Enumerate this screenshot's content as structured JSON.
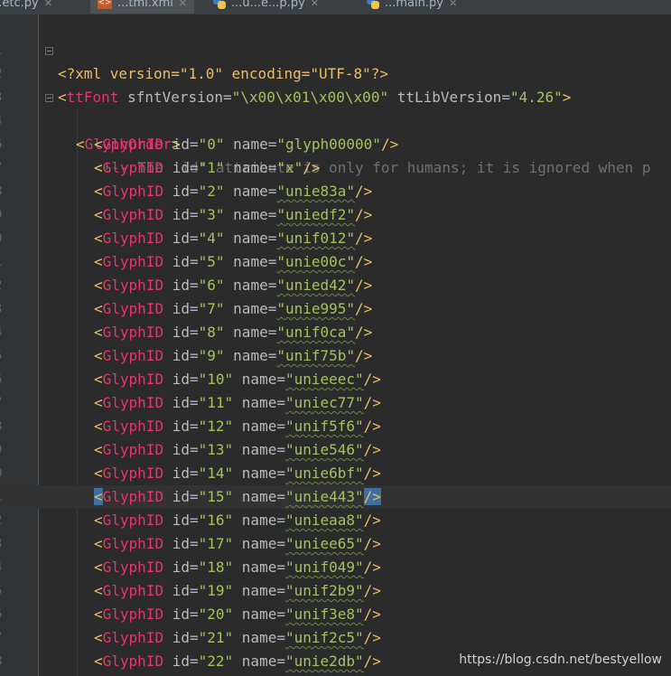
{
  "tabs": [
    {
      "label": "...etc.py",
      "icon": "python-file-icon"
    },
    {
      "label": "...tml.xml",
      "icon": "xml-file-icon"
    },
    {
      "label": "...u...e...p.py",
      "icon": "python-file-icon"
    },
    {
      "label": "...main.py",
      "icon": "python-file-icon"
    }
  ],
  "editor": {
    "header_lines": [
      {
        "num": "1",
        "pi": "<?xml version=\"1.0\" encoding=\"UTF-8\"?>"
      },
      {
        "num": "2",
        "tag": "ttFont",
        "attr1": "sfntVersion",
        "val1": "\"\\x00\\x01\\x00\\x00\"",
        "attr2": "ttLibVersion",
        "val2": "\"4.26\""
      },
      {
        "num": "3"
      },
      {
        "num": "4",
        "tag": "GlyphOrder"
      },
      {
        "num": "5",
        "comment": "<!-- The 'id' attribute is only for humans; it is ignored when p"
      }
    ],
    "glyphs": [
      {
        "num": "6",
        "id": "\"0\"",
        "name": "\"glyph00000\"",
        "underline": false
      },
      {
        "num": "7",
        "id": "\"1\"",
        "name": "\"x\"",
        "underline": false
      },
      {
        "num": "8",
        "id": "\"2\"",
        "name": "\"unie83a\"",
        "underline": true
      },
      {
        "num": "9",
        "id": "\"3\"",
        "name": "\"uniedf2\"",
        "underline": true
      },
      {
        "num": "0",
        "id": "\"4\"",
        "name": "\"unif012\"",
        "underline": true
      },
      {
        "num": "1",
        "id": "\"5\"",
        "name": "\"unie00c\"",
        "underline": true
      },
      {
        "num": "2",
        "id": "\"6\"",
        "name": "\"unied42\"",
        "underline": true
      },
      {
        "num": "3",
        "id": "\"7\"",
        "name": "\"unie995\"",
        "underline": true
      },
      {
        "num": "4",
        "id": "\"8\"",
        "name": "\"unif0ca\"",
        "underline": true
      },
      {
        "num": "5",
        "id": "\"9\"",
        "name": "\"unif75b\"",
        "underline": true
      },
      {
        "num": "6",
        "id": "\"10\"",
        "name": "\"unieeec\"",
        "underline": true
      },
      {
        "num": "7",
        "id": "\"11\"",
        "name": "\"uniec77\"",
        "underline": true
      },
      {
        "num": "8",
        "id": "\"12\"",
        "name": "\"unif5f6\"",
        "underline": true
      },
      {
        "num": "9",
        "id": "\"13\"",
        "name": "\"unie546\"",
        "underline": true
      },
      {
        "num": "0",
        "id": "\"14\"",
        "name": "\"unie6bf\"",
        "underline": true
      },
      {
        "num": "1",
        "id": "\"15\"",
        "name": "\"unie443\"",
        "underline": true,
        "current": true
      },
      {
        "num": "2",
        "id": "\"16\"",
        "name": "\"unieaa8\"",
        "underline": true
      },
      {
        "num": "3",
        "id": "\"17\"",
        "name": "\"uniee65\"",
        "underline": true
      },
      {
        "num": "4",
        "id": "\"18\"",
        "name": "\"unif049\"",
        "underline": true
      },
      {
        "num": "5",
        "id": "\"19\"",
        "name": "\"unif2b9\"",
        "underline": true
      },
      {
        "num": "6",
        "id": "\"20\"",
        "name": "\"unif3e8\"",
        "underline": true
      },
      {
        "num": "7",
        "id": "\"21\"",
        "name": "\"unif2c5\"",
        "underline": true
      },
      {
        "num": "8",
        "id": "\"22\"",
        "name": "\"unie2db\"",
        "underline": true
      }
    ],
    "glyph_tag": "GlyphID",
    "attr_id": "id",
    "attr_name": "name"
  },
  "watermark": "https://blog.csdn.net/bestyellow",
  "colors": {
    "background": "#2b2b2b",
    "tag": "#e8346f",
    "attribute": "#bababa",
    "value": "#a5c261",
    "bracket": "#e8bf6a",
    "comment": "#707070",
    "highlight": "#3d6fa0"
  }
}
